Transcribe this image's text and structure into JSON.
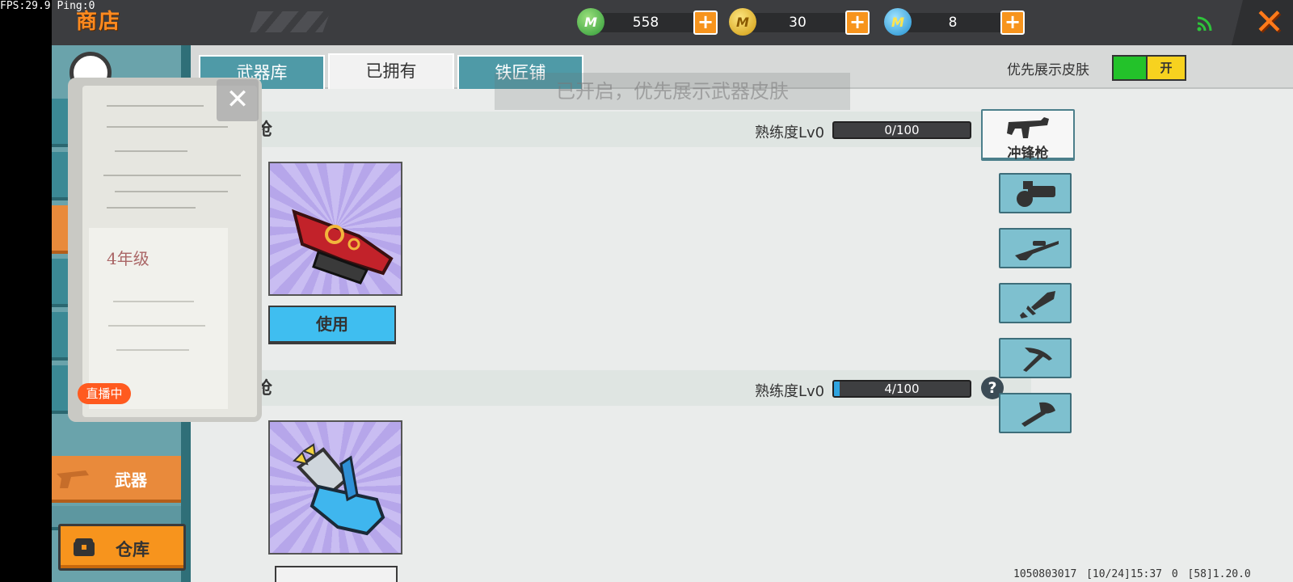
{
  "status": {
    "fps": "FPS:29.9  Ping:0"
  },
  "header": {
    "title": "商店",
    "currencies": [
      {
        "icon": "green-gem-icon",
        "value": "558",
        "color": "#4cb84c"
      },
      {
        "icon": "gold-coin-icon",
        "value": "30",
        "color": "#e8b81c"
      },
      {
        "icon": "blue-token-icon",
        "value": "8",
        "color": "#33aadd"
      }
    ]
  },
  "tabs": [
    {
      "label": "武器库"
    },
    {
      "label": "已拥有"
    },
    {
      "label": "铁匠铺"
    }
  ],
  "preference": {
    "label": "优先展示皮肤",
    "toggle": "开"
  },
  "toast": "已开启，优先展示武器皮肤",
  "sections": [
    {
      "name": "枪",
      "prof_label": "熟练度Lv0",
      "prof_text": "0/100",
      "prof_fraction": 0.0
    },
    {
      "name": "枪",
      "prof_label": "熟练度Lv0",
      "prof_text": "4/100",
      "prof_fraction": 0.04
    }
  ],
  "use_button": "使用",
  "categories": {
    "active_label": "冲锋枪",
    "items": [
      "submachine-gun-icon",
      "gatling-gun-icon",
      "sniper-rifle-icon",
      "dagger-icon",
      "pickaxe-icon",
      "axe-icon"
    ]
  },
  "sidebar": {
    "weapon_label": "武器",
    "warehouse_label": "仓库"
  },
  "live": {
    "badge": "直播中",
    "handwriting": "4年级"
  },
  "footer": "1050803017  [10/24]15:37 0  [58]1.20.0"
}
